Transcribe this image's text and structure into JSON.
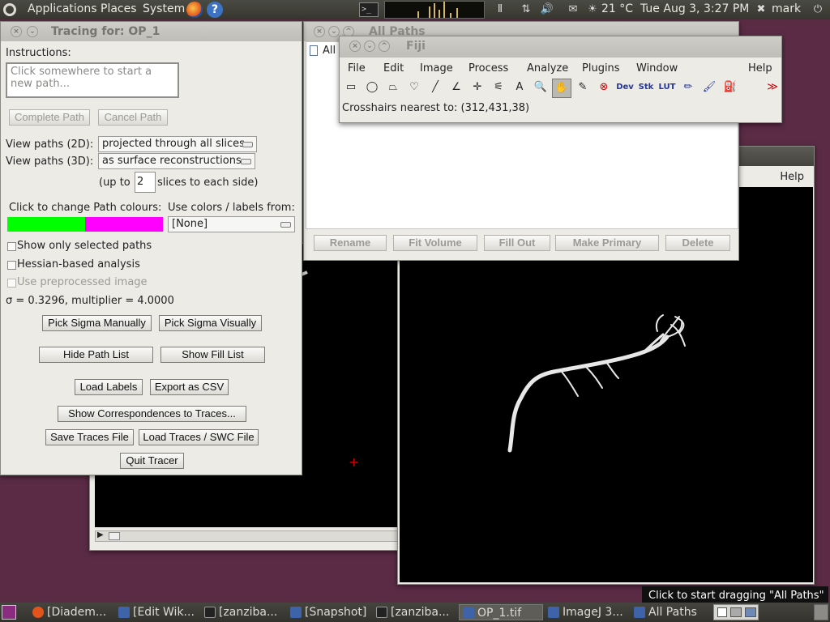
{
  "top_panel": {
    "menus": [
      "Applications",
      "Places",
      "System"
    ],
    "weather": "21 °C",
    "clock": "Tue Aug  3,  3:27 PM",
    "user": "mark"
  },
  "image_window_left": {
    "title": "OP_1.tif"
  },
  "image_window_right": {
    "help": "Help"
  },
  "all_paths": {
    "title": "All Paths",
    "tree_root": "All Paths",
    "buttons": [
      "Rename",
      "Fit Volume",
      "Fill Out",
      "Make Primary",
      "Delete"
    ]
  },
  "fiji": {
    "title": "Fiji",
    "menus": [
      "File",
      "Edit",
      "Image",
      "Process",
      "Analyze",
      "Plugins",
      "Window",
      "Help"
    ],
    "tools": [
      "rectangle-tool",
      "oval-tool",
      "polygon-tool",
      "freehand-tool",
      "line-tool",
      "angle-tool",
      "point-tool",
      "wand-tool",
      "text-tool",
      "zoom-tool",
      "hand-tool",
      "color-picker-tool",
      "close-tool",
      "dev-tool",
      "stk-tool",
      "lut-tool",
      "pencil-tool",
      "brush-tool",
      "flood-fill-tool",
      "more-tools"
    ],
    "tool_labels": {
      "text": "A",
      "dev": "Dev",
      "stk": "Stk",
      "lut": "LUT",
      "more": "≫"
    },
    "status": "Crosshairs nearest to: (312,431,38)"
  },
  "tracer": {
    "title": "Tracing for: OP_1",
    "instructions_label": "Instructions:",
    "instructions_text": "Click somewhere to start a new path...",
    "complete_path": "Complete Path",
    "cancel_path": "Cancel Path",
    "view2d_label": "View paths (2D):",
    "view2d_value": "projected through all slices",
    "view3d_label": "View paths (3D):",
    "view3d_value": "as surface reconstructions",
    "upto_prefix": "(up to",
    "upto_value": "2",
    "upto_suffix": "slices to each side)",
    "colour_label": "Click to change Path colours:",
    "use_colors_label": "Use colors / labels from:",
    "use_colors_value": "[None]",
    "colors": {
      "selected": "#00ff00",
      "deselected": "#ff00ff"
    },
    "show_selected": "Show only selected paths",
    "hessian": "Hessian-based analysis",
    "preprocessed": "Use preprocessed image",
    "sigma_text": "σ = 0.3296, multiplier = 4.0000",
    "pick_sigma_manual": "Pick Sigma Manually",
    "pick_sigma_visual": "Pick Sigma Visually",
    "hide_path_list": "Hide Path List",
    "show_fill_list": "Show Fill List",
    "load_labels": "Load Labels",
    "export_csv": "Export as CSV",
    "show_correspondences": "Show Correspondences to Traces...",
    "save_traces": "Save Traces File",
    "load_traces": "Load Traces / SWC File",
    "quit_tracer": "Quit Tracer"
  },
  "taskbar": {
    "tasks": [
      "[Diadem...",
      "[Edit Wik...",
      "[zanziba...",
      "[Snapshot]",
      "[zanziba...",
      "OP_1.tif",
      "ImageJ 3...",
      "All Paths"
    ],
    "active_index": 5
  },
  "tooltip": "Click to start dragging \"All Paths\""
}
